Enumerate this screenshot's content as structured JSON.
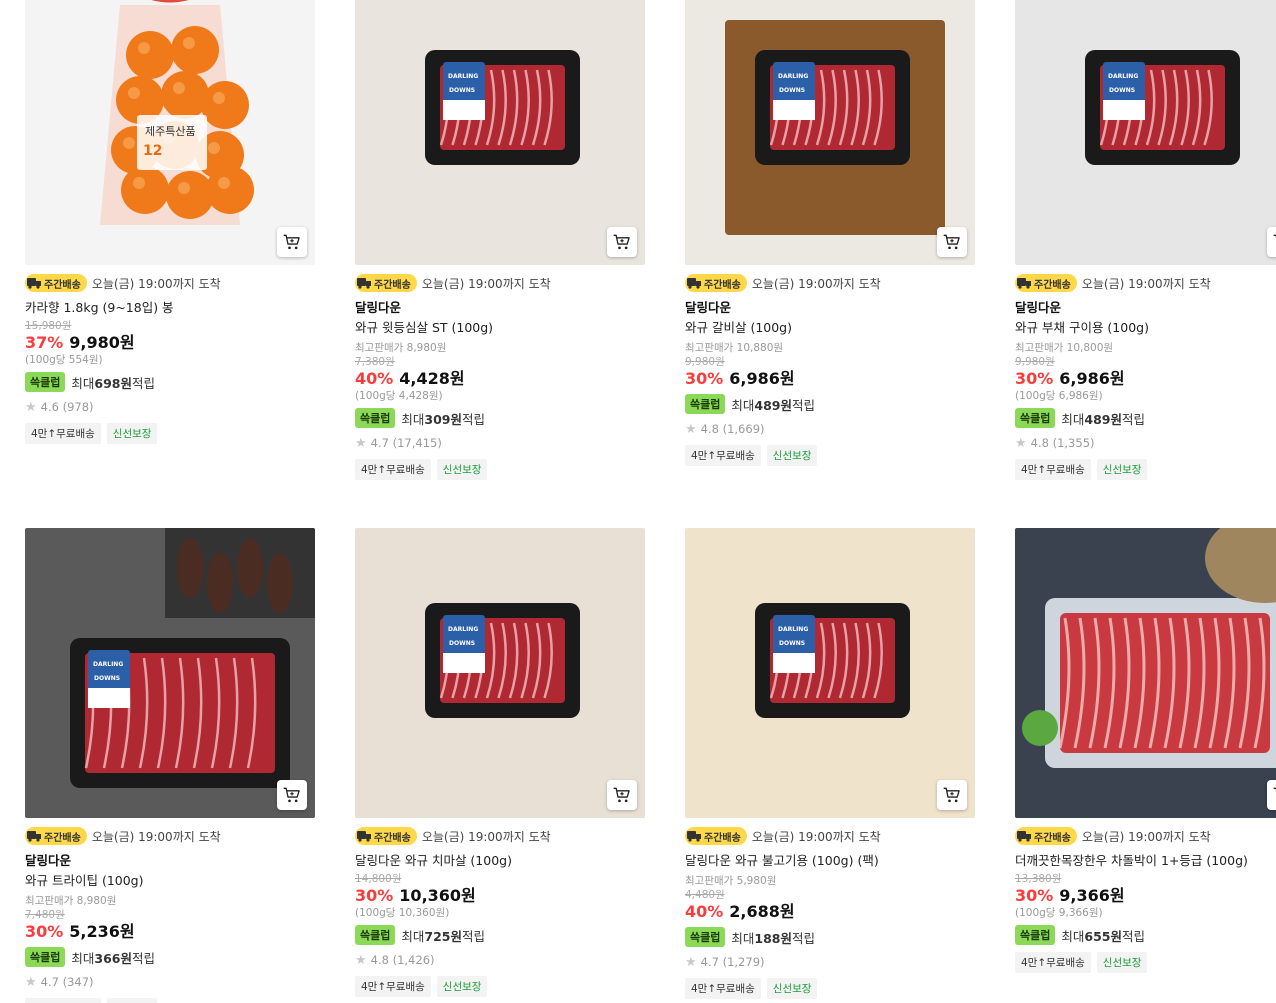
{
  "delivery_badge": "주간배송",
  "delivery_text": "오늘(금) 19:00까지 도착",
  "max_price_prefix": "최고판매가",
  "points_tag": "쓱클럽",
  "points_prefix": "최대",
  "points_suffix": "적립",
  "chip_free": "4만↑무료배송",
  "chip_fresh": "신선보장",
  "products": [
    {
      "brand": "",
      "name": "카라향 1.8kg (9~18입) 봉",
      "max_price": "",
      "orig": "15,980원",
      "rate": "37%",
      "price": "9,980원",
      "unit": "(100g당 554원)",
      "points": "698원",
      "rating": "4.6 (978)",
      "image": "mandarin-bag",
      "bg": "#f4f4f4"
    },
    {
      "brand": "달링다운",
      "name": "와규 윗등심살 ST (100g)",
      "max_price": "8,980원",
      "orig": "7,380원",
      "rate": "40%",
      "price": "4,428원",
      "unit": "(100g당 4,428원)",
      "points": "309원",
      "rating": "4.7 (17,415)",
      "image": "beef-tray",
      "bg": "#e9e5de"
    },
    {
      "brand": "달링다운",
      "name": "와규 갈비살 (100g)",
      "max_price": "10,880원",
      "orig": "9,980원",
      "rate": "30%",
      "price": "6,986원",
      "unit": "",
      "points": "489원",
      "rating": "4.8 (1,669)",
      "image": "beef-tray-board",
      "bg": "#ece8e2"
    },
    {
      "brand": "달링다운",
      "name": "와규 부채 구이용 (100g)",
      "max_price": "10,800원",
      "orig": "9,980원",
      "rate": "30%",
      "price": "6,986원",
      "unit": "(100g당 6,986원)",
      "points": "489원",
      "rating": "4.8 (1,355)",
      "image": "beef-tray",
      "bg": "#e6e6e6"
    },
    {
      "brand": "달링다운",
      "name": "와규 트라이팁 (100g)",
      "max_price": "8,980원",
      "orig": "7,480원",
      "rate": "30%",
      "price": "5,236원",
      "unit": "",
      "points": "366원",
      "rating": "4.7 (347)",
      "image": "beef-tray-dark",
      "bg": "#5a5a5a"
    },
    {
      "brand": "",
      "name": "달링다운 와규 치마살 (100g)",
      "max_price": "",
      "orig": "14,800원",
      "rate": "30%",
      "price": "10,360원",
      "unit": "(100g당 10,360원)",
      "points": "725원",
      "rating": "4.8 (1,426)",
      "image": "beef-tray",
      "bg": "#e8e0d4"
    },
    {
      "brand": "",
      "name": "달링다운 와규 불고기용 (100g) (팩)",
      "max_price": "5,980원",
      "orig": "4,480원",
      "rate": "40%",
      "price": "2,688원",
      "unit": "",
      "points": "188원",
      "rating": "4.7 (1,279)",
      "image": "beef-tray",
      "bg": "#efe3cc"
    },
    {
      "brand": "",
      "name": "더깨끗한목장한우 차돌박이 1+등급 (100g)",
      "max_price": "",
      "orig": "13,380원",
      "rate": "30%",
      "price": "9,366원",
      "unit": "(100g당 9,366원)",
      "points": "655원",
      "rating": "",
      "image": "beef-clear-tray",
      "bg": "#3a4250"
    }
  ]
}
